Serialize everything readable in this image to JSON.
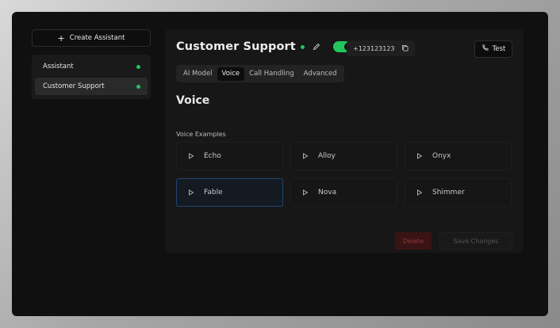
{
  "sidebar": {
    "create_label": "Create Assistant",
    "items": [
      {
        "label": "Assistant",
        "status": "active"
      },
      {
        "label": "Customer Support",
        "status": "active"
      }
    ]
  },
  "header": {
    "title": "Customer Support",
    "enabled": true,
    "phone": "+123123123",
    "test_label": "Test"
  },
  "tabs": [
    "AI Model",
    "Voice",
    "Call Handling",
    "Advanced"
  ],
  "active_tab": "Voice",
  "section": {
    "title": "Voice",
    "examples_label": "Voice Examples",
    "voices": [
      "Echo",
      "Alloy",
      "Onyx",
      "Fable",
      "Nova",
      "Shimmer"
    ],
    "selected_voice": "Fable"
  },
  "actions": {
    "delete_label": "Delete",
    "save_label": "Save Changes"
  },
  "colors": {
    "accent_green": "#22c55e",
    "selected_border": "#22466e",
    "delete_bg": "#3a1414"
  }
}
